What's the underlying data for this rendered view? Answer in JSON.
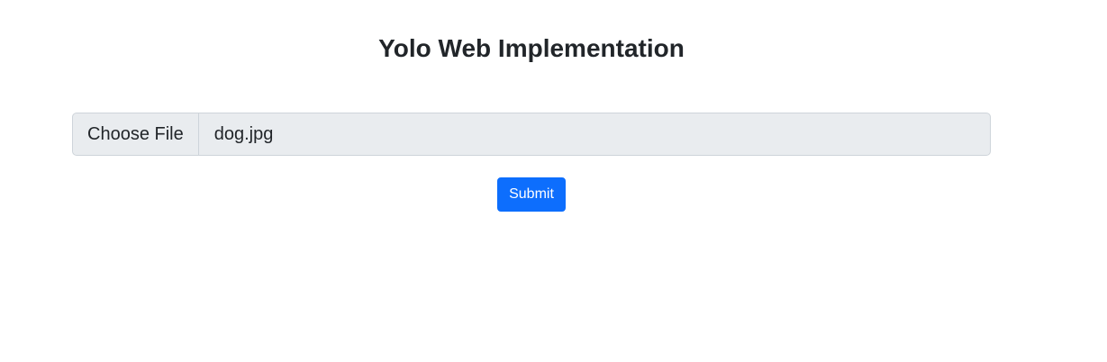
{
  "header": {
    "title": "Yolo Web Implementation"
  },
  "form": {
    "file_input": {
      "button_label": "Choose File",
      "value": "dog.jpg"
    },
    "submit_label": "Submit"
  },
  "colors": {
    "primary": "#0d6efd",
    "input_bg": "#e9ecef",
    "input_border": "#ced4da",
    "text": "#212529"
  }
}
